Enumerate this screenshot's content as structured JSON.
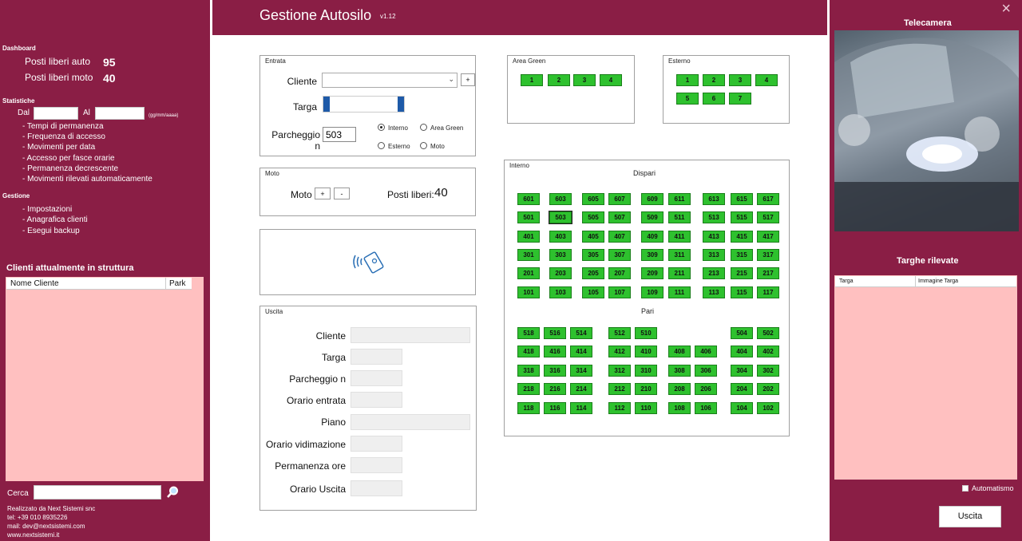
{
  "header": {
    "title": "Gestione Autosilo",
    "version": "v1.12"
  },
  "left": {
    "dashboard_title": "Dashboard",
    "free_cars_label": "Posti liberi auto",
    "free_cars_value": "95",
    "free_moto_label": "Posti liberi moto",
    "free_moto_value": "40",
    "stats_title": "Statistiche",
    "dal_label": "Dal",
    "al_label": "Al",
    "date_hint": "(gg/mm/aaaa)",
    "stats_links": [
      "- Tempi di permanenza",
      "- Frequenza di accesso",
      "- Movimenti per data",
      "- Accesso per fasce orarie",
      "- Permanenza decrescente",
      "- Movimenti rilevati automaticamente"
    ],
    "gestione_title": "Gestione",
    "gestione_links": [
      "- Impostazioni",
      "- Anagrafica clienti",
      "- Esegui backup"
    ],
    "clients_title": "Clienti attualmente in struttura",
    "clients_col1": "Nome Cliente",
    "clients_col2": "Park",
    "search_label": "Cerca",
    "footer": [
      "Realizzato da Next Sistemi snc",
      "tel: +39 010 8935226",
      "mail: dev@nextsistemi.com",
      "www.nextsistemi.it"
    ]
  },
  "entrata": {
    "title": "Entrata",
    "cliente_label": "Cliente",
    "plus_label": "+",
    "targa_label": "Targa",
    "parcheggio_label": "Parcheggio n",
    "parcheggio_value": "503",
    "radio_interno": "Interno",
    "radio_area_green": "Area Green",
    "radio_esterno": "Esterno",
    "radio_moto": "Moto"
  },
  "moto": {
    "title": "Moto",
    "label": "Moto",
    "plus": "+",
    "minus": "-",
    "free_label": "Posti liberi:",
    "free_value": "40"
  },
  "uscita": {
    "title": "Uscita",
    "labels": [
      "Cliente",
      "Targa",
      "Parcheggio n",
      "Orario entrata",
      "Piano",
      "Orario vidimazione",
      "Permanenza ore",
      "Orario Uscita"
    ]
  },
  "area_green": {
    "title": "Area Green",
    "spots": [
      "1",
      "2",
      "3",
      "4"
    ]
  },
  "esterno": {
    "title": "Esterno",
    "spots_row1": [
      "1",
      "2",
      "3",
      "4"
    ],
    "spots_row2": [
      "5",
      "6",
      "7"
    ]
  },
  "interno": {
    "title": "Interno",
    "dispari_label": "Dispari",
    "pari_label": "Pari",
    "dispari_rows": [
      [
        "601",
        "603",
        "605",
        "607",
        "609",
        "611",
        "613",
        "615",
        "617"
      ],
      [
        "501",
        "503",
        "505",
        "507",
        "509",
        "511",
        "513",
        "515",
        "517"
      ],
      [
        "401",
        "403",
        "405",
        "407",
        "409",
        "411",
        "413",
        "415",
        "417"
      ],
      [
        "301",
        "303",
        "305",
        "307",
        "309",
        "311",
        "313",
        "315",
        "317"
      ],
      [
        "201",
        "203",
        "205",
        "207",
        "209",
        "211",
        "213",
        "215",
        "217"
      ],
      [
        "101",
        "103",
        "105",
        "107",
        "109",
        "111",
        "113",
        "115",
        "117"
      ]
    ],
    "pari_rows": [
      [
        "518",
        "516",
        "514",
        "512",
        "510",
        "504",
        "502"
      ],
      [
        "418",
        "416",
        "414",
        "412",
        "410",
        "408",
        "406",
        "404",
        "402"
      ],
      [
        "318",
        "316",
        "314",
        "312",
        "310",
        "308",
        "306",
        "304",
        "302"
      ],
      [
        "218",
        "216",
        "214",
        "212",
        "210",
        "208",
        "206",
        "204",
        "202"
      ],
      [
        "118",
        "116",
        "114",
        "112",
        "110",
        "108",
        "106",
        "104",
        "102"
      ]
    ]
  },
  "right": {
    "camera_title": "Telecamera",
    "targhe_title": "Targhe rilevate",
    "targhe_col1": "Targa",
    "targhe_col2": "Immagine Targa",
    "auto_label": "Automatismo",
    "uscita_button": "Uscita",
    "close_icon": "×"
  },
  "colors": {
    "brand": "#8a1e45",
    "spot_green": "#2ec12e",
    "list_pink": "#ffc0c0"
  }
}
